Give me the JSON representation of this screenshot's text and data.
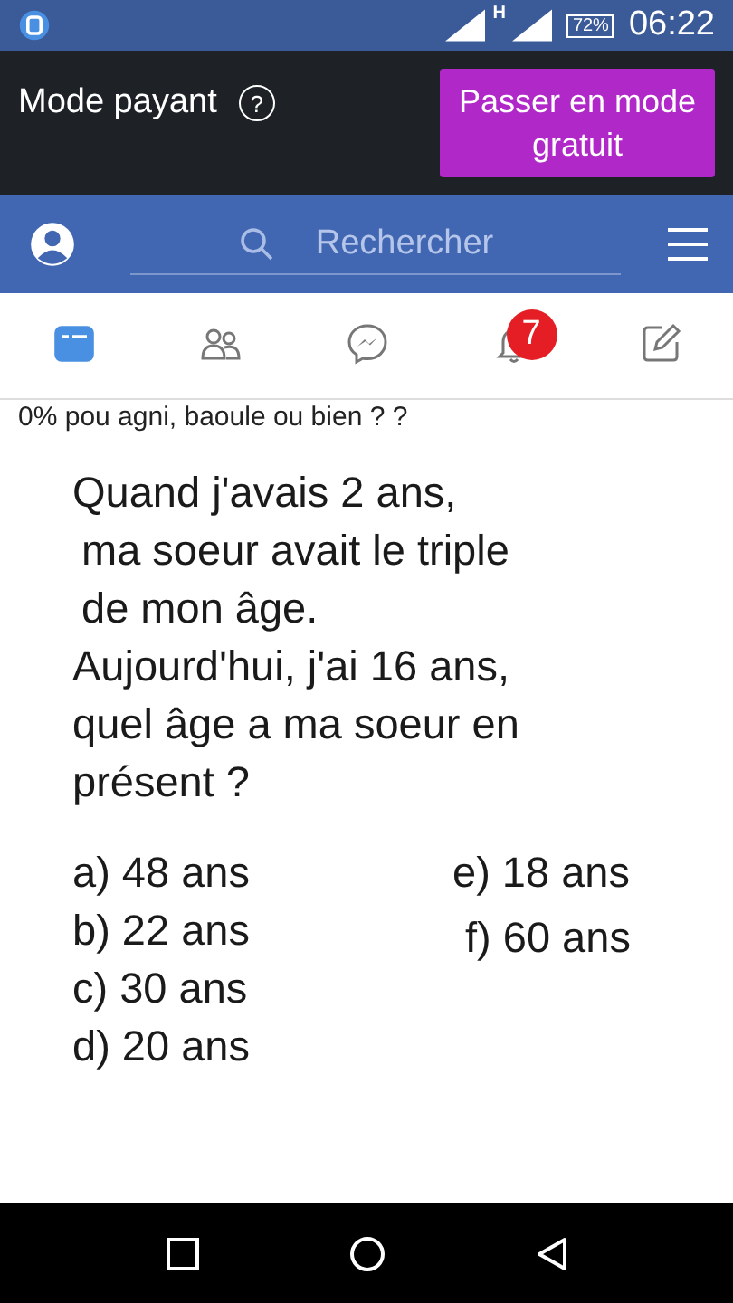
{
  "status_bar": {
    "network": "H",
    "battery": "72%",
    "time": "06:22"
  },
  "data_banner": {
    "label": "Mode payant",
    "help": "?",
    "button": "Passer en mode gratuit"
  },
  "header": {
    "search": {
      "placeholder": "Rechercher"
    }
  },
  "tabs": [
    {
      "kind": "feed",
      "selected": true
    },
    {
      "kind": "friends",
      "selected": false
    },
    {
      "kind": "messenger",
      "selected": false
    },
    {
      "kind": "notifications",
      "selected": false,
      "badge": "7"
    },
    {
      "kind": "compose",
      "selected": false
    }
  ],
  "post": {
    "caption": "0% pou agni, baoule ou bien ? ?",
    "question_lines": [
      "Quand j'avais 2 ans,",
      "ma soeur avait le triple",
      "de mon âge.",
      "Aujourd'hui, j'ai 16 ans,",
      "quel âge a ma soeur en",
      "présent ?"
    ],
    "answers_left": [
      "a) 48 ans",
      "b) 22 ans",
      "c) 30 ans",
      "d) 20 ans"
    ],
    "answers_right": [
      "e) 18 ans",
      "f) 60 ans"
    ]
  }
}
